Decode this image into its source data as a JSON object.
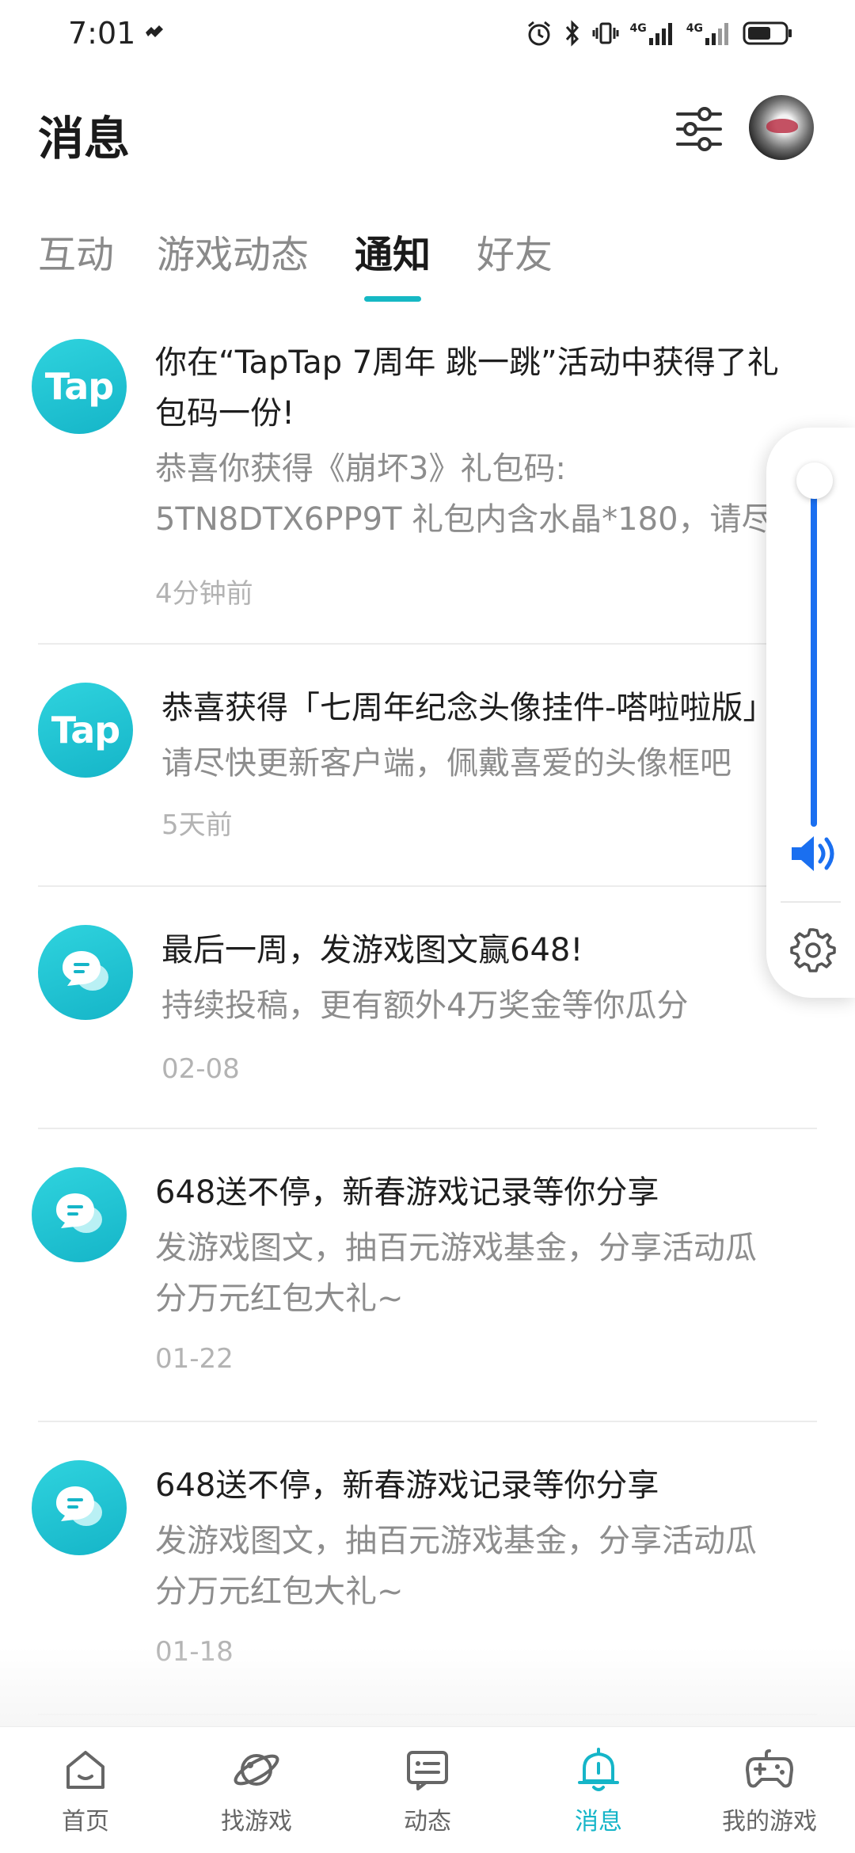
{
  "status_bar": {
    "time": "7:01",
    "network_labels": [
      "4G",
      "4G"
    ]
  },
  "header": {
    "title": "消息"
  },
  "tabs": [
    {
      "label": "互动",
      "active": false
    },
    {
      "label": "游戏动态",
      "active": false
    },
    {
      "label": "通知",
      "active": true
    },
    {
      "label": "好友",
      "active": false
    }
  ],
  "notifications": [
    {
      "icon": "taptap-logo",
      "icon_text": "Tap",
      "title": "你在“TapTap 7周年 跳一跳”活动中获得了礼\n包码一份!",
      "body": "恭喜你获得《崩坏3》礼包码:\n5TN8DTX6PP9T 礼包内含水晶*180，请尽…",
      "time": "4分钟前"
    },
    {
      "icon": "taptap-logo",
      "icon_text": "Tap",
      "title": "恭喜获得「七周年纪念头像挂件-嗒啦啦版」",
      "body": "请尽快更新客户端，佩戴喜爱的头像框吧",
      "time": "5天前"
    },
    {
      "icon": "chat-bubble-icon",
      "title": "最后一周，发游戏图文赢648!",
      "body": "持续投稿，更有额外4万奖金等你瓜分",
      "time": "02-08"
    },
    {
      "icon": "chat-bubble-icon",
      "title": "648送不停，新春游戏记录等你分享",
      "body": "发游戏图文，抽百元游戏基金，分享活动瓜\n分万元红包大礼~",
      "time": "01-22"
    },
    {
      "icon": "chat-bubble-icon",
      "title": "648送不停，新春游戏记录等你分享",
      "body": "发游戏图文，抽百元游戏基金，分享活动瓜\n分万元红包大礼~",
      "time": "01-18"
    }
  ],
  "volume": {
    "level": 0.95,
    "accent": "#1a6ff0"
  },
  "bottom_nav": [
    {
      "label": "首页",
      "icon": "home-icon",
      "active": false
    },
    {
      "label": "找游戏",
      "icon": "planet-icon",
      "active": false
    },
    {
      "label": "动态",
      "icon": "feed-icon",
      "active": false
    },
    {
      "label": "消息",
      "icon": "bell-icon",
      "active": true
    },
    {
      "label": "我的游戏",
      "icon": "gamepad-icon",
      "active": false
    }
  ],
  "colors": {
    "accent": "#15b5c8",
    "indicator": "#16b8c4"
  }
}
